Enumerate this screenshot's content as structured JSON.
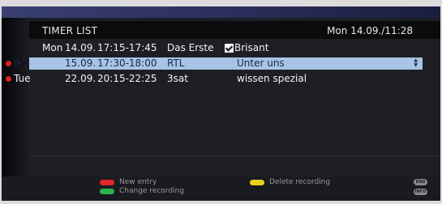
{
  "header": {
    "title": "TIMER LIST",
    "datetime": "Mon 14.09./11:28"
  },
  "timers": [
    {
      "day": "Mon",
      "date": "14.09.",
      "time": "17:15-17:45",
      "channel": "Das Erste",
      "program": "Brisant",
      "recording": false,
      "repeat": false,
      "checked": true,
      "selected": false
    },
    {
      "day": "",
      "date": "15.09.",
      "time": "17:30-18:00",
      "channel": "RTL",
      "program": "Unter uns",
      "recording": true,
      "repeat": true,
      "checked": false,
      "selected": true
    },
    {
      "day": "Tue",
      "date": "22.09.",
      "time": "20:15-22:25",
      "channel": "3sat",
      "program": "wissen spezial",
      "recording": true,
      "repeat": false,
      "checked": false,
      "selected": false
    }
  ],
  "footer": {
    "red_label": "New entry",
    "green_label": "Change recording",
    "yellow_label": "Delete recording",
    "end_key": "END",
    "info_key": "INFO"
  },
  "colors": {
    "red_key": "#e2262a",
    "green_key": "#2fb34a",
    "yellow_key": "#e8d21c",
    "selection": "#a7c4e6",
    "record_dot": "#e0201e"
  }
}
